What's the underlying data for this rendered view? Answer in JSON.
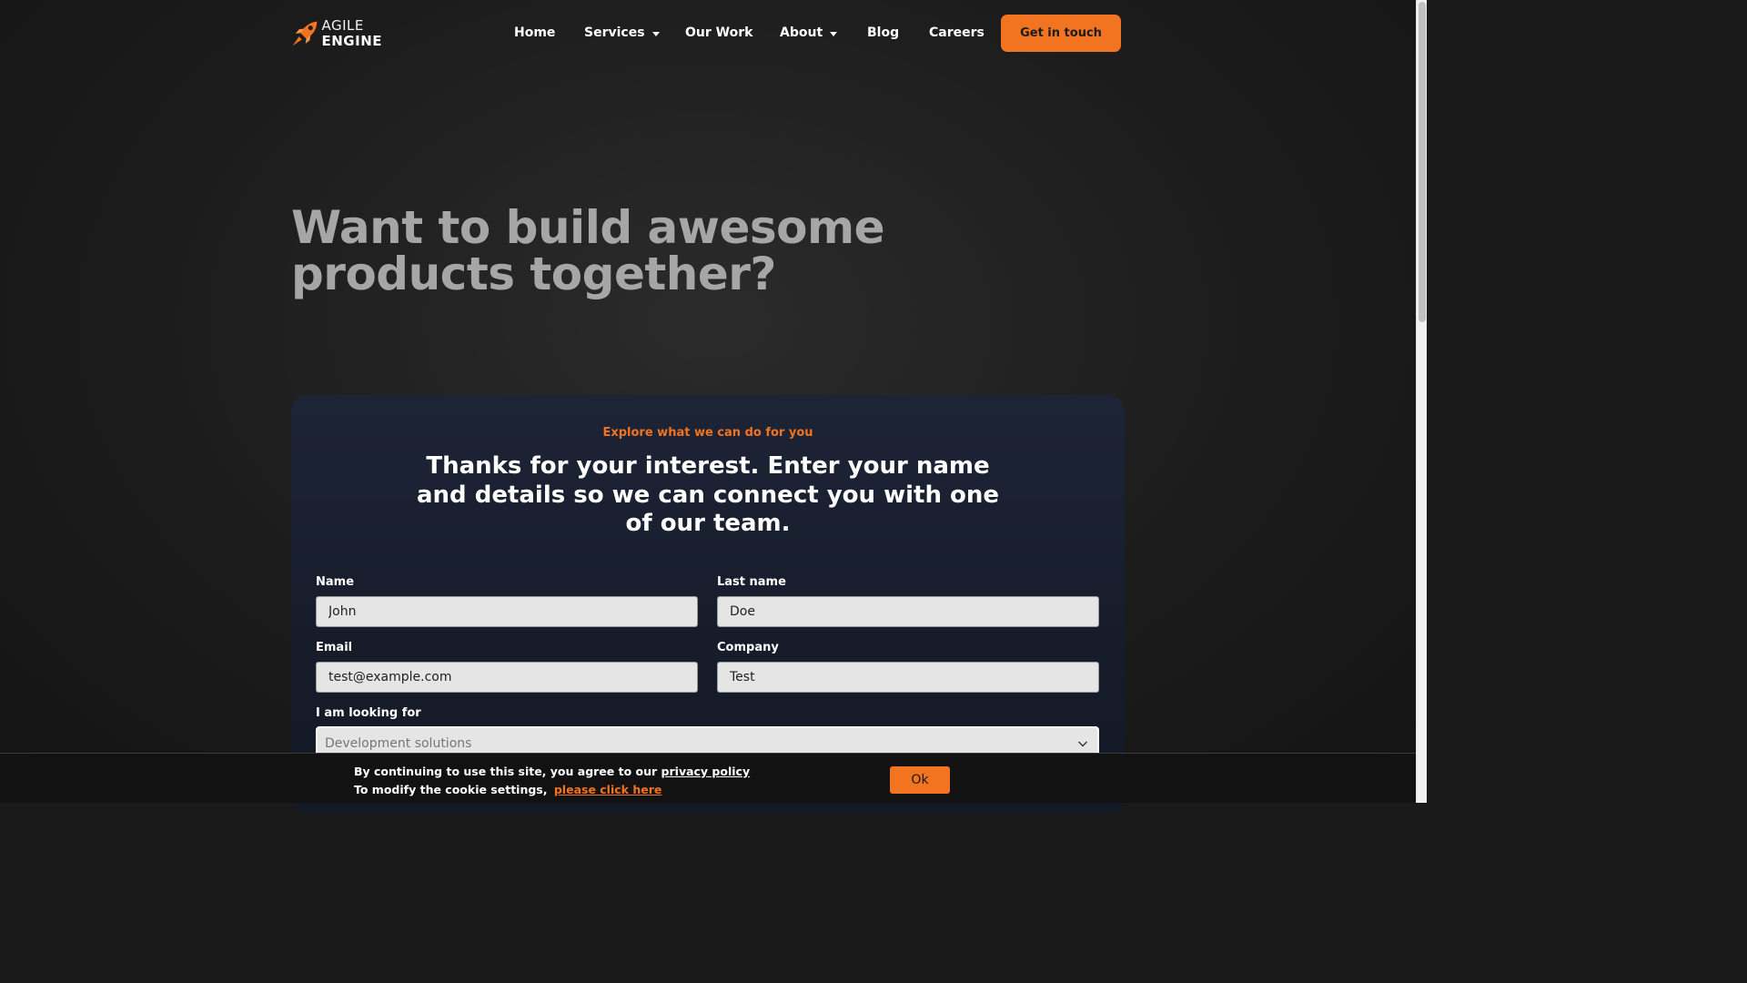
{
  "logo": {
    "line1": "AGILE",
    "line2": "ENGINE"
  },
  "nav": {
    "items": [
      {
        "label": "Home"
      },
      {
        "label": "Services"
      },
      {
        "label": "Our Work"
      },
      {
        "label": "About"
      },
      {
        "label": "Blog"
      },
      {
        "label": "Careers"
      }
    ],
    "cta_label": "Get in touch"
  },
  "hero": {
    "title": "Want to build awesome products together?"
  },
  "form": {
    "eyebrow": "Explore what we can do for you",
    "title": "Thanks for your interest. Enter your name and details so we can connect you with one of our team.",
    "name_label": "Name",
    "name_value": "John",
    "last_name_label": "Last name",
    "last_name_value": "Doe",
    "email_label": "Email",
    "email_value": "test@example.com",
    "company_label": "Company",
    "company_value": "Test",
    "looking_for_label": "I am looking for",
    "looking_for_value": "Development solutions"
  },
  "cookie": {
    "text1": "By continuing to use this site, you agree to our",
    "privacy_link": "privacy policy",
    "text2": "To modify the cookie settings,",
    "settings_link": "please click here",
    "ok_label": "Ok"
  },
  "colors": {
    "accent": "#f27320",
    "background": "#1c1c1c",
    "card": "#1d2436"
  }
}
